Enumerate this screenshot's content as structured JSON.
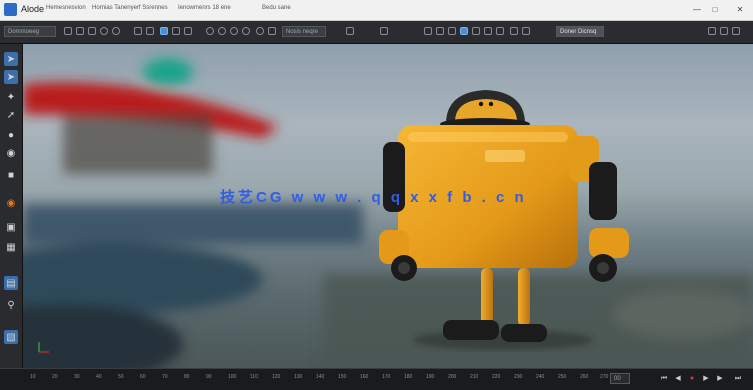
{
  "app": {
    "name": "Alode",
    "logo_icon": "app-logo-icon"
  },
  "menus": [
    "Hemesnesvion",
    "Hornias Tanenyerf Ssrennes",
    "Ienowmenrs 18 ene",
    "Bedu sane"
  ],
  "window_controls": [
    "minimize",
    "maximize",
    "close"
  ],
  "toolbar": {
    "left_field": "Dommoeeg",
    "mid_field": "Nosis neqre",
    "right_button": "Doner Dicnsq"
  },
  "watermark": "技艺CG  w w w . q q x x f b . c n",
  "timeline": {
    "ticks": [
      "10",
      "20",
      "30",
      "40",
      "50",
      "60",
      "70",
      "80",
      "90",
      "100",
      "110",
      "120",
      "130",
      "140",
      "150",
      "160",
      "170",
      "180",
      "190",
      "200",
      "210",
      "220",
      "230",
      "240",
      "250",
      "260",
      "270"
    ],
    "current_frame": "00"
  },
  "colors": {
    "accent": "#3c6fa8",
    "robot_body": "#e8a21f",
    "robot_dark": "#1b1b1c"
  }
}
